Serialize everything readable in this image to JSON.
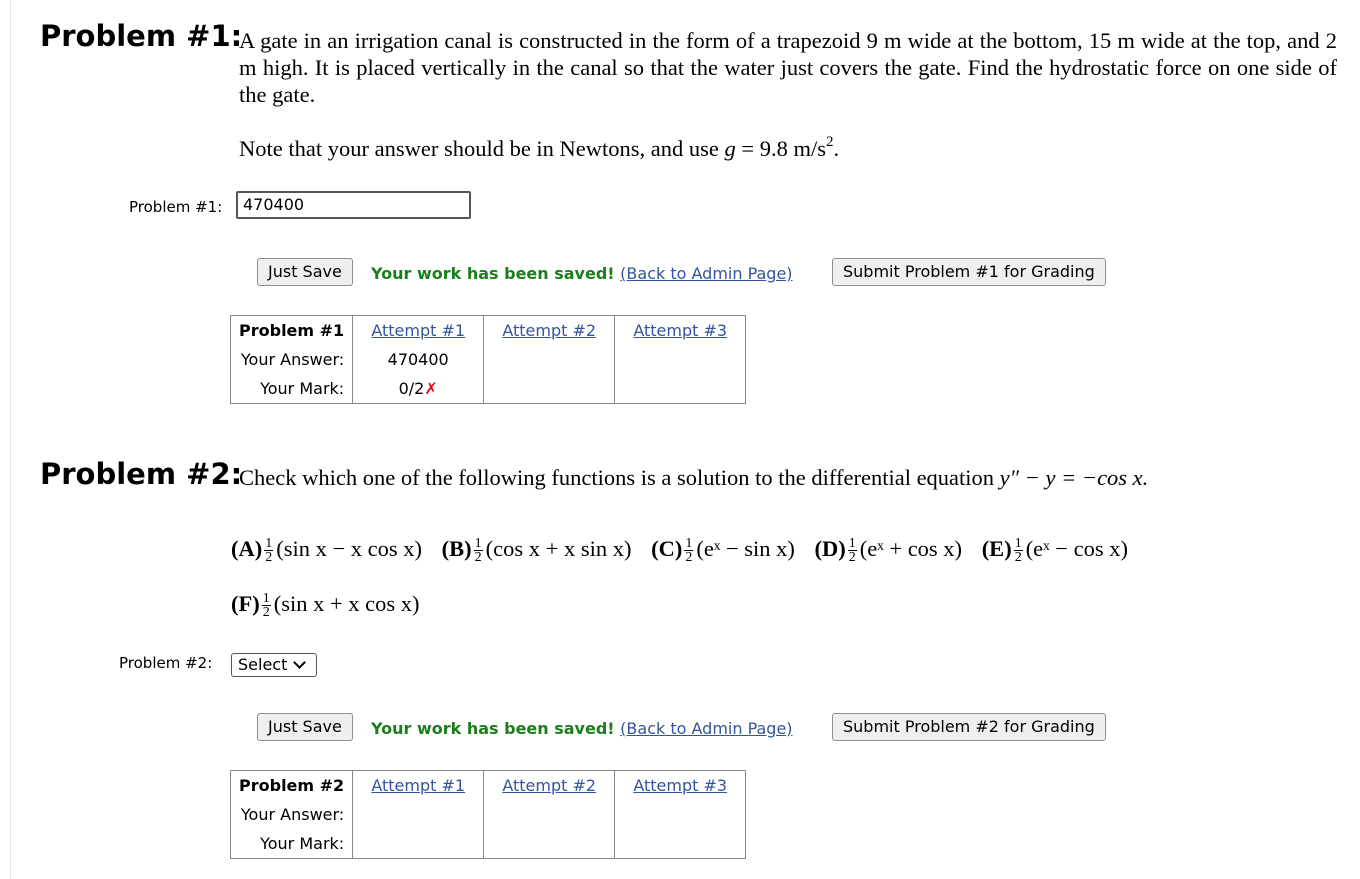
{
  "problem1": {
    "heading": "Problem #1:",
    "text_parts": {
      "p1": "A gate in an irrigation canal is constructed in the form of a trapezoid 9 m wide at the bottom, 15 m wide at the top, and 2 m high. It is placed vertically in the canal so that the water just covers the gate. Find the hydrostatic force on one side of the gate.",
      "note_pre": "Note that your answer should be in Newtons, and use ",
      "note_var": "g",
      "note_eq": " = 9.8 m/s",
      "note_exp": "2",
      "note_end": "."
    },
    "answer_label": "Problem #1:",
    "answer_value": "470400",
    "just_save": "Just Save",
    "saved_msg": "Your work has been saved!",
    "admin_link": "(Back to Admin Page)",
    "submit": "Submit Problem #1 for Grading",
    "table": {
      "header": "Problem #1",
      "attempts": [
        "Attempt #1",
        "Attempt #2",
        "Attempt #3"
      ],
      "answer_label": "Your Answer:",
      "mark_label": "Your Mark:",
      "answers": [
        "470400",
        "",
        ""
      ],
      "marks": [
        "0/2",
        "",
        ""
      ],
      "mark_symbol": "✗"
    }
  },
  "problem2": {
    "heading": "Problem #2:",
    "text_pre": "Check which one of the following functions is a solution to the differential equation ",
    "equation": "y″ − y = −cos x.",
    "choices": [
      {
        "letter": "(A)",
        "expr": "(sin x − x cos x)"
      },
      {
        "letter": "(B)",
        "expr": "(cos x + x sin x)"
      },
      {
        "letter": "(C)",
        "expr": "(eˣ − sin x)"
      },
      {
        "letter": "(D)",
        "expr": "(eˣ + cos x)"
      },
      {
        "letter": "(E)",
        "expr": "(eˣ − cos x)"
      },
      {
        "letter": "(F)",
        "expr": "(sin x + x cos x)"
      }
    ],
    "fraction": {
      "num": "1",
      "den": "2"
    },
    "answer_label": "Problem #2:",
    "select_value": "Select",
    "just_save": "Just Save",
    "saved_msg": "Your work has been saved!",
    "admin_link": "(Back to Admin Page)",
    "submit": "Submit Problem #2 for Grading",
    "table": {
      "header": "Problem #2",
      "attempts": [
        "Attempt #1",
        "Attempt #2",
        "Attempt #3"
      ],
      "answer_label": "Your Answer:",
      "mark_label": "Your Mark:"
    }
  }
}
